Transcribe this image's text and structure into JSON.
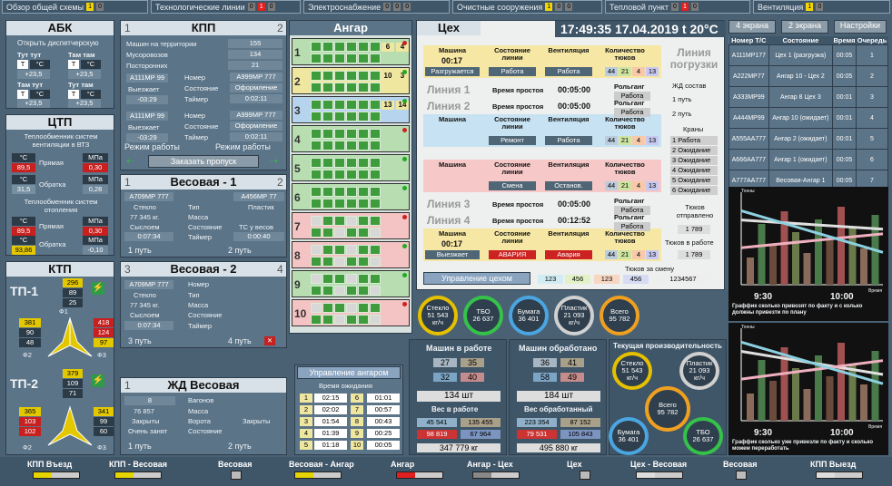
{
  "tabs": [
    {
      "label": "Обзор общей схемы",
      "badges": [
        "1",
        "0"
      ]
    },
    {
      "label": "Технологические линии",
      "badges": [
        "0",
        "1",
        "0"
      ]
    },
    {
      "label": "Электроснабжение",
      "badges": [
        "0",
        "0",
        "0"
      ]
    },
    {
      "label": "Очистные сооружения",
      "badges": [
        "1",
        "0",
        "0"
      ]
    },
    {
      "label": "Тепловой пункт",
      "badges": [
        "0",
        "1",
        "0"
      ]
    },
    {
      "label": "Вентиляция",
      "badges": [
        "1",
        "0"
      ]
    }
  ],
  "abk": {
    "title": "АБК",
    "subtitle": "Открыть диспетчерскую",
    "rooms": [
      {
        "name": "Тут тут",
        "t": "T",
        "u": "°C",
        "val": "+23,5"
      },
      {
        "name": "Там там",
        "t": "T",
        "u": "°C",
        "val": "+23,5"
      },
      {
        "name": "Там тут",
        "t": "T",
        "u": "°C",
        "val": "+23,5"
      },
      {
        "name": "Тут там",
        "t": "T",
        "u": "°C",
        "val": "+23,5"
      }
    ]
  },
  "ctp": {
    "title": "ЦТП",
    "vent_title": "Теплообменник систем вентиляции в ВТЗ",
    "heat_title": "Теплообменник систем отопления",
    "rows": [
      {
        "tv": "89,5",
        "tu": "°C",
        "name": "Прямая",
        "pv": "0,30",
        "pu": "МПа"
      },
      {
        "tv": "31,5",
        "tu": "°C",
        "name": "Обратка",
        "pv": "0,28",
        "pu": "МПа"
      },
      {
        "tv": "89,5",
        "tu": "°C",
        "name": "Прямая",
        "pv": "0,30",
        "pu": "МПа"
      },
      {
        "tv": "93,86",
        "tu": "°C",
        "name": "Обратка",
        "pv": "-0,10",
        "pu": "МПа"
      }
    ]
  },
  "ktp": {
    "title": "КТП",
    "tp1": {
      "name": "ТП-1",
      "top": [
        "296",
        "89",
        "25"
      ],
      "left": [
        "381",
        "90",
        "48"
      ],
      "right": [
        "418",
        "124",
        "97"
      ]
    },
    "tp2": {
      "name": "ТП-2",
      "top": [
        "379",
        "109",
        "71"
      ],
      "left": [
        "365",
        "103",
        "102"
      ],
      "right": [
        "341",
        "99",
        "60"
      ]
    },
    "phases": [
      "Ф1",
      "Ф2",
      "Ф3"
    ],
    "vai": [
      "V",
      "A",
      "I"
    ]
  },
  "kpp": {
    "title": "КПП",
    "n1": "1",
    "n2": "2",
    "rows": [
      {
        "l": "Машин на территории",
        "v": "155"
      },
      {
        "l": "Мусоровозов",
        "v": "134"
      },
      {
        "l": "Посторонних",
        "v": "21"
      }
    ],
    "cars": [
      {
        "plate": "А111МР 99",
        "status": "Выезжает",
        "time": "-03:29",
        "num_l": "Номер",
        "num_v": "А999МР 777",
        "st_l": "Состояние",
        "st_v": "Оформление",
        "tm_l": "Таймер",
        "tm_v": "0:02:11"
      },
      {
        "plate": "А111МР 99",
        "status": "Выезжает",
        "time": "-03:29",
        "num_l": "Номер",
        "num_v": "А999МР 777",
        "st_l": "Состояние",
        "st_v": "Оформление",
        "tm_l": "Таймер",
        "tm_v": "0:02:11"
      }
    ],
    "mode1": "Режим работы",
    "mode2": "Режим работы",
    "pass_btn": "Заказать пропуск"
  },
  "scale1": {
    "title": "Весовая - 1",
    "n1": "1",
    "n2": "2",
    "plate1": "А709МР 777",
    "plate2": "А456МР 77",
    "c1": [
      "Стекло",
      "77 345 кг.",
      "Сыслоем",
      "0:07:34"
    ],
    "c2": [
      "Тип",
      "Масса",
      "Состояние",
      "Таймер"
    ],
    "c3": [
      "Пластик",
      "",
      "ТС у весов",
      "0:00:40"
    ],
    "p1": "1 путь",
    "p2": "2 путь"
  },
  "scale2": {
    "title": "Весовая - 2",
    "n1": "3",
    "n2": "4",
    "plate1": "А709МР 777",
    "c1": [
      "Стекло",
      "77 345 кг.",
      "Сыслоем",
      "0:07:34"
    ],
    "c2": [
      "Номер",
      "Тип",
      "Масса",
      "Состояние",
      "Таймер"
    ],
    "p1": "3 путь",
    "p2": "4 путь"
  },
  "zd": {
    "title": "ЖД Весовая",
    "n1": "1",
    "vals": [
      "8",
      "76 857",
      "Закрыты",
      "Очень занят"
    ],
    "labels": [
      "Вагонов",
      "Масса",
      "Ворота",
      "Состояние"
    ],
    "extra": "Закрыты",
    "p1": "1 путь",
    "p2": "2 путь"
  },
  "angar": {
    "title": "Ангар",
    "rows": [
      {
        "id": "1",
        "a": "6",
        "b": "4"
      },
      {
        "id": "2",
        "a": "10",
        "b": "3"
      },
      {
        "id": "3",
        "a": "13",
        "b": "14"
      },
      {
        "id": "4",
        "a": "",
        "": ""
      },
      {
        "id": "5",
        "a": "",
        "b": ""
      },
      {
        "id": "6",
        "a": "",
        "b": ""
      },
      {
        "id": "7",
        "a": "",
        "b": ""
      },
      {
        "id": "8",
        "a": "",
        "b": ""
      },
      {
        "id": "9",
        "a": "",
        "b": ""
      },
      {
        "id": "10",
        "a": "",
        "b": ""
      }
    ],
    "hangar_mgmt": "Управление ангаром",
    "wait_title": "Время ожидания",
    "waits": [
      {
        "n": "1",
        "t": "02:15",
        "n2": "6",
        "t2": "01:01"
      },
      {
        "n": "2",
        "t": "02:02",
        "n2": "7",
        "t2": "00:57"
      },
      {
        "n": "3",
        "t": "01:54",
        "n2": "8",
        "t2": "00:43"
      },
      {
        "n": "4",
        "t": "01:39",
        "n2": "9",
        "t2": "00:25"
      },
      {
        "n": "5",
        "t": "01:18",
        "n2": "10",
        "t2": "00:05"
      }
    ]
  },
  "tsekh": {
    "title": "Цех",
    "clock": "17:49:35",
    "date": "17.04.2019",
    "temp": "t 20°C",
    "h1": [
      "Машина",
      "Состояние линии",
      "Вентиляция",
      "Количество тюков"
    ],
    "lines": [
      {
        "time": "00:17",
        "state": "Разгружается",
        "line": "Работа",
        "vent": "Работа",
        "bales": [
          "44",
          "21",
          "4",
          "13"
        ],
        "idle_l": "Время простоя",
        "idle": "00:05:00",
        "roll": "Рольганг",
        "roll_v": "Работа",
        "name": "Линия 1"
      },
      {
        "name": "Линия 2",
        "idle": "00:05:00",
        "roll_v": "Работа",
        "state": "",
        "line": "Ремонт",
        "vent": "Работа",
        "bales": [
          "44",
          "21",
          "4",
          "13"
        ]
      },
      {
        "name": "Линия 3",
        "idle": "00:05:00",
        "roll_v": "Работа",
        "line": "Смена",
        "vent": "Останов.",
        "bales": [
          "44",
          "21",
          "4",
          "13"
        ]
      },
      {
        "name": "Линия 4",
        "idle": "00:12:52",
        "roll_v": "Работа",
        "time": "00:17",
        "state": "Выезжает",
        "line": "АВАРИЯ",
        "vent": "Авария",
        "bales": [
          "44",
          "21",
          "4",
          "13"
        ]
      }
    ],
    "mgmt": "Управление цехом",
    "shift_title": "Тюков за смену",
    "shift": [
      "123",
      "456",
      "123",
      "456",
      "1234567"
    ]
  },
  "loading": {
    "title": "Линия погрузки",
    "zd": "ЖД состав",
    "p1": "1 путь",
    "p2": "2 путь",
    "cranes": "Краны",
    "crane_states": [
      "Работа",
      "Ожидание",
      "Ожидание",
      "Ожидание",
      "Ожидание",
      "Ожидание"
    ],
    "sent_l": "Тюков отправлено",
    "sent": "1 789",
    "inwork_l": "Тюков в работе",
    "inwork": "1 789"
  },
  "top_right": {
    "b1": "4 экрана",
    "b2": "2 экрана",
    "b3": "Настройки",
    "headers": [
      "Номер Т/С",
      "Состояние",
      "Время",
      "Очередь"
    ],
    "rows": [
      [
        "А111МР177",
        "Цех 1 (разгрузка)",
        "00:05",
        "1"
      ],
      [
        "А222МР77",
        "Ангар 10 - Цех 2",
        "00:05",
        "2"
      ],
      [
        "А333МР99",
        "Ангар 8 Цех 3",
        "00:01",
        "3"
      ],
      [
        "А444МР99",
        "Ангар 10 (ожидает)",
        "00:01",
        "4"
      ],
      [
        "А555АА777",
        "Ангар 2 (ожидает)",
        "00:01",
        "5"
      ],
      [
        "А666АА777",
        "Ангар 1 (ожидает)",
        "00:05",
        "6"
      ],
      [
        "А777АА777",
        "Весовая-Ангар 1",
        "00:05",
        "7"
      ]
    ]
  },
  "gauges_top": [
    {
      "name": "Стекло",
      "v": "51 543",
      "u": "кг/ч"
    },
    {
      "name": "ТБО",
      "v": "26 637",
      "u": ""
    },
    {
      "name": "Бумага",
      "v": "36 401",
      "u": ""
    },
    {
      "name": "Пластик",
      "v": "21 093",
      "u": "кг/ч"
    },
    {
      "name": "Всего",
      "v": "95 782",
      "u": ""
    }
  ],
  "inwork": {
    "title": "Машин в работе",
    "vals": [
      "27",
      "35",
      "32",
      "40"
    ],
    "count": "134 шт",
    "weight_title": "Вес в работе",
    "w": [
      "45 541",
      "135 455",
      "98 819",
      "67 964"
    ],
    "total": "347 779 кг"
  },
  "done": {
    "title": "Машин обработано",
    "vals": [
      "36",
      "41",
      "58",
      "49"
    ],
    "count": "184 шт",
    "weight_title": "Вес обработанный",
    "w": [
      "223 354",
      "87 152",
      "79 531",
      "105 843"
    ],
    "total": "495 880 кг"
  },
  "perf": {
    "title": "Текущая производительность",
    "g": [
      {
        "name": "Стекло",
        "v": "51 543",
        "u": "кг/ч"
      },
      {
        "name": "Пластик",
        "v": "21 093",
        "u": "кг/ч"
      },
      {
        "name": "Всего",
        "v": "95 782",
        "u": ""
      },
      {
        "name": "Бумага",
        "v": "36 401",
        "u": ""
      },
      {
        "name": "ТБО",
        "v": "26 637",
        "u": ""
      }
    ]
  },
  "charts": {
    "t1": "9:30",
    "t2": "10:00",
    "t3": "Время",
    "cap1": "Граффик сколько привозят по факту и с колько должны привезти по плану",
    "cap2": "Граффик сколько уже привезли по факту и сколько можем переработать",
    "ylab": "Тонны"
  },
  "chart_data": [
    {
      "type": "line",
      "title": "",
      "x": [
        "9:30",
        "10:00"
      ],
      "series": [
        {
          "values": [
            70,
            60
          ]
        },
        {
          "values": [
            40,
            55
          ]
        },
        {
          "values": [
            80,
            35
          ]
        }
      ]
    },
    {
      "type": "line",
      "title": "",
      "x": [
        "9:30",
        "10:00"
      ],
      "series": [
        {
          "values": [
            75,
            50
          ]
        },
        {
          "values": [
            45,
            65
          ]
        },
        {
          "values": [
            85,
            40
          ]
        }
      ]
    }
  ],
  "bottom": [
    {
      "label": "КПП Въезд",
      "min": "0",
      "max": "10"
    },
    {
      "label": "КПП - Весовая",
      "min": "0",
      "max": "5"
    },
    {
      "label": "Весовая",
      "min": "",
      "max": ""
    },
    {
      "label": "Весовая - Ангар",
      "min": "0",
      "max": "50"
    },
    {
      "label": "Ангар",
      "min": "0",
      "max": "50 100"
    },
    {
      "label": "Ангар - Цех",
      "min": "0",
      "max": "20 40"
    },
    {
      "label": "Цех",
      "min": "",
      "max": ""
    },
    {
      "label": "Цех - Весовая",
      "min": "0",
      "max": "10"
    },
    {
      "label": "Весовая",
      "min": "",
      "max": ""
    },
    {
      "label": "КПП Выезд",
      "min": "0",
      "max": "10"
    }
  ]
}
